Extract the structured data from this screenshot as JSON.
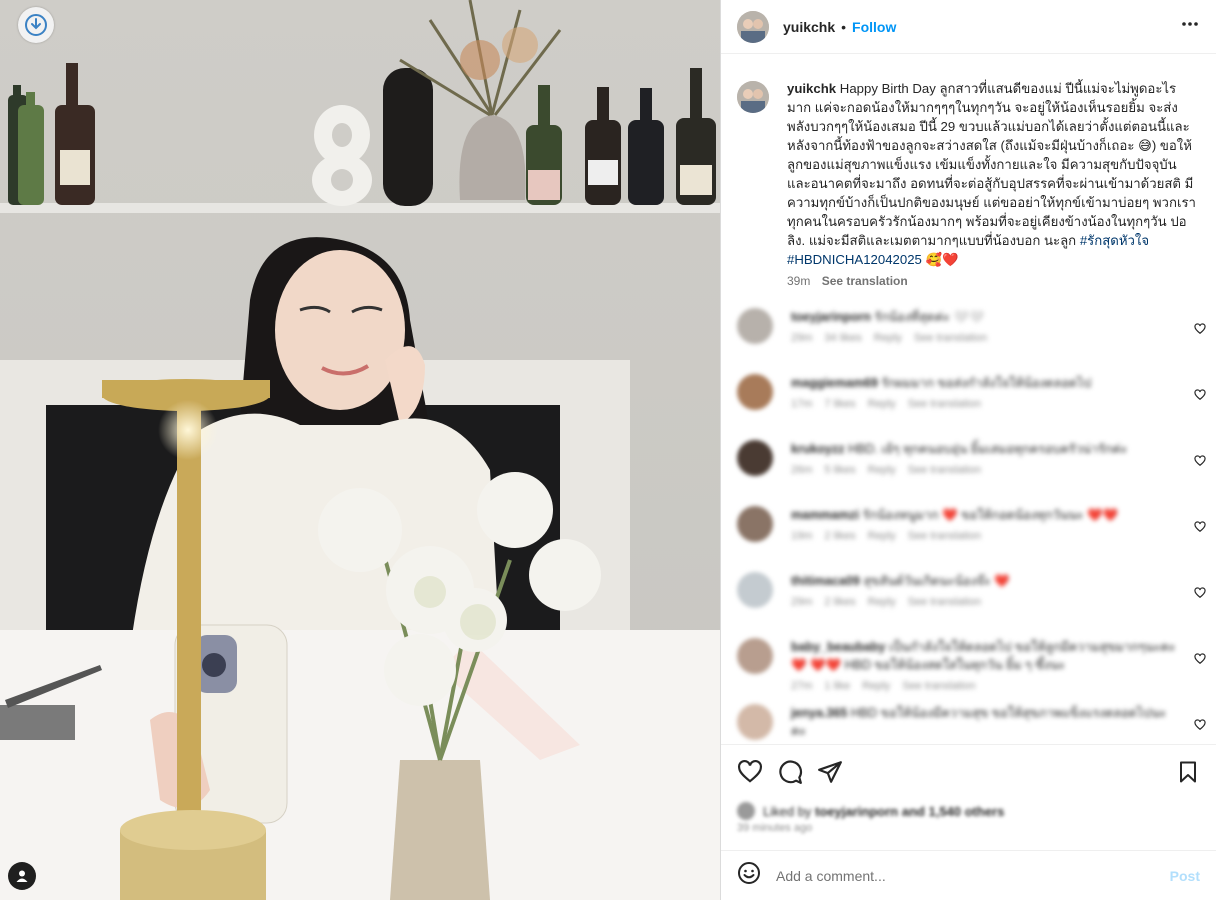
{
  "colors": {
    "accent": "#0095f6",
    "heart_red": "#e0245e",
    "hashtag": "#00376b"
  },
  "post": {
    "download_icon": "download-circle-icon",
    "tag_icon": "user-tag-icon"
  },
  "header": {
    "username": "yuikchk",
    "separator": "•",
    "follow_label": "Follow",
    "more_icon": "more-horizontal-icon"
  },
  "caption": {
    "username": "yuikchk",
    "text": "Happy Birth Day ลูกสาวที่แสนดีของแม่ ปีนี้แม่จะไม่พูดอะไรมาก แค่จะกอดน้องให้มากๆๆๆในทุกๆวัน จะอยู่ให้น้องเห็นรอยยิ้ม จะส่งพลังบวกๆๆให้น้องเสมอ ปีนี้ 29 ขวบแล้วแม่บอกได้เลยว่าตั้งแต่ตอนนี้และหลังจากนี้ท้องฟ้าของลูกจะสว่างสดใส (ถึงแม้จะมีฝุ่นบ้างก็เถอะ 😅) ขอให้ลูกของแม่สุขภาพแข็งแรง เข้มแข็งทั้งกายและใจ มีความสุขกับปัจจุบันและอนาคตที่จะมาถึง อดทนที่จะต่อสู้กับอุปสรรคที่จะผ่านเข้ามาด้วยสติ มีความทุกข์บ้างก็เป็นปกติของมนุษย์ แต่ขออย่าให้ทุกข์เข้ามาบ่อยๆ พวกเราทุกคนในครอบครัวรักน้องมากๆ พร้อมที่จะอยู่เคียงข้างน้องในทุกๆวัน ปอลิง. แม่จะมีสติและเมตตามากๆแบบที่น้องบอก นะลูก",
    "hashtag1": "#รักสุดหัวใจ",
    "hashtag2": "#HBDNICHA12042025",
    "emoji": "🥰❤️",
    "time": "39m",
    "see_translation": "See translation"
  },
  "comments": [
    {
      "username": "toeyjarinporn",
      "text": "รักน้องที่สุดค่ะ 🤍🤍",
      "time": "29m",
      "likes": "34 likes",
      "reply": "Reply",
      "see_translation": "See translation",
      "avatar_color": "#b7b1ab"
    },
    {
      "username": "maggiemam69",
      "text": "รักผมมาก ขอส่งกำลังใจให้น้องตลอดไป",
      "time": "17m",
      "likes": "7 likes",
      "reply": "Reply",
      "see_translation": "See translation",
      "avatar_color": "#a87b5a"
    },
    {
      "username": "krukoyzz",
      "text": "HBD. เย้ๆ ทุกคนอบอุ่น ยิ้มเสมอทุกครอบครัวน่ารักค่ะ",
      "time": "26m",
      "likes": "5 likes",
      "reply": "Reply",
      "see_translation": "See translation",
      "avatar_color": "#4a3b33"
    },
    {
      "username": "mammamzi",
      "text": "รักน้องหนูมาก ❤️ ขอให้กอดน้องทุกวันนะ ❤️❤️",
      "time": "19m",
      "likes": "2 likes",
      "reply": "Reply",
      "see_translation": "See translation",
      "avatar_color": "#8a7466"
    },
    {
      "username": "thitimaca09",
      "text": "สุขสันต์วันเกิดนะน้องจ๊ะ ❤️",
      "time": "29m",
      "likes": "2 likes",
      "reply": "Reply",
      "see_translation": "See translation",
      "avatar_color": "#c4cbd0"
    },
    {
      "username": "baby_beaubaby",
      "text": "เป็นกำลังใจให้ตลอดไป ขอให้ลูกมีความสุขมากๆนะคะ ❤️ ❤️❤️ HBD ขอให้น้องสดใสในทุกวัน ยิ้ม ๆ ซึ้งนะ",
      "time": "27m",
      "likes": "1 like",
      "reply": "Reply",
      "see_translation": "See translation",
      "avatar_color": "#b89e8f"
    },
    {
      "username": "jenya.365",
      "text": "HBD ขอให้น้องมีความสุข ขอให้สุขภาพแข็งแรงตลอดไปนะคะ",
      "time": "",
      "likes": "",
      "reply": "",
      "see_translation": "",
      "avatar_color": "#d3b9a8"
    }
  ],
  "actions": {
    "like_icon": "heart-outline-icon",
    "comment_icon": "comment-icon",
    "share_icon": "share-send-icon",
    "save_icon": "bookmark-icon",
    "liked_by_prefix": "Liked by",
    "liked_by_user": "toeyjarinporn",
    "liked_by_suffix": "and 1,540 others",
    "timestamp": "39 minutes ago"
  },
  "add_comment": {
    "emoji_icon": "emoji-smiley-icon",
    "placeholder": "Add a comment...",
    "post_label": "Post"
  }
}
